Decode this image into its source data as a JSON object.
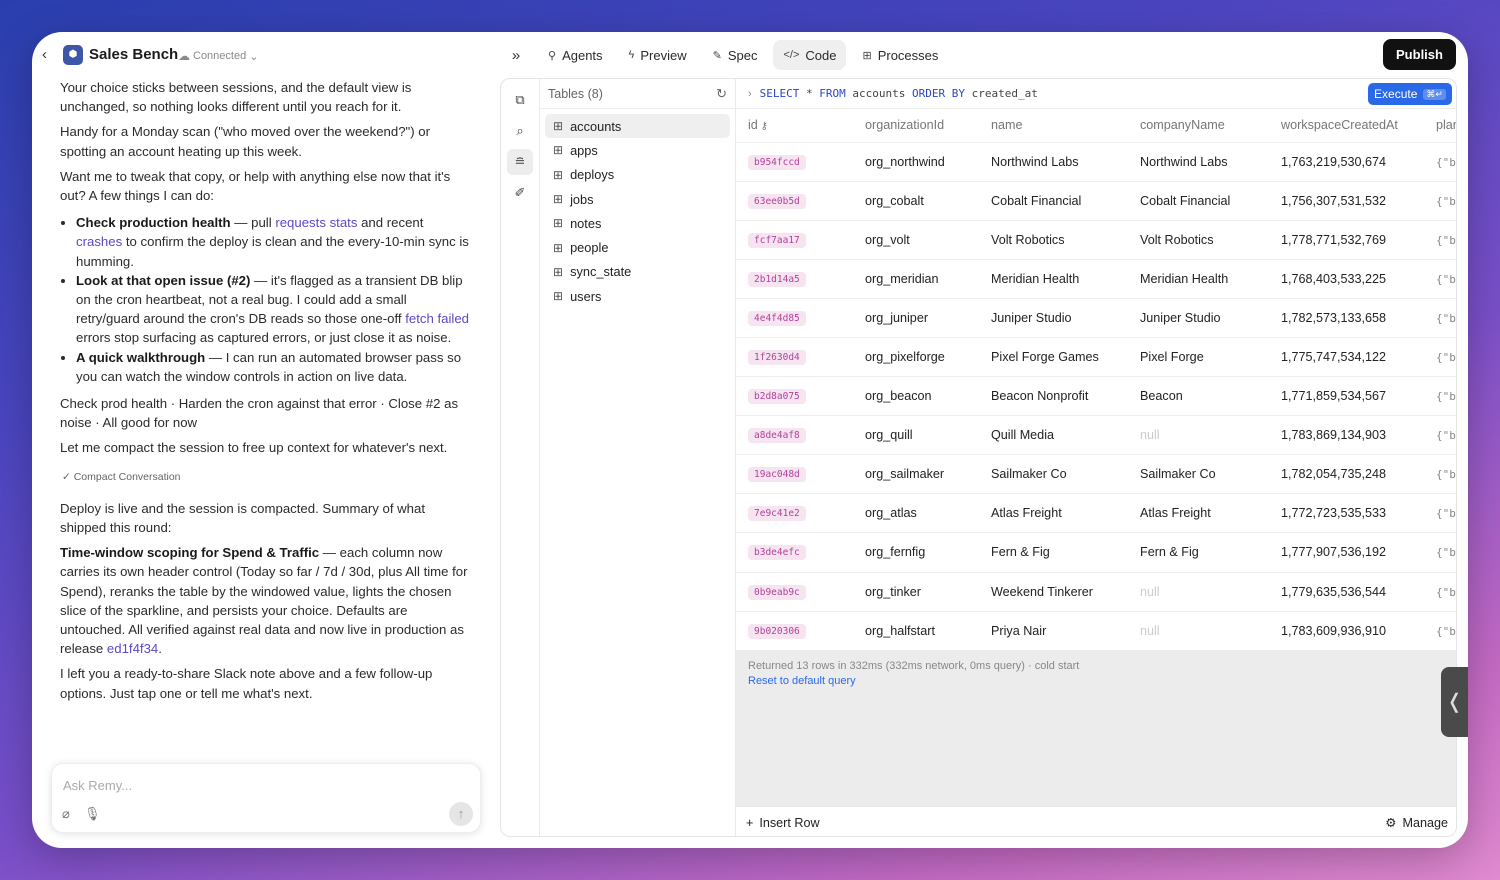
{
  "header": {
    "back_icon": "chevron-left-icon",
    "app_icon": "app-logo-icon",
    "title": "Sales Bench",
    "connection": "Connected",
    "tabs": [
      {
        "label": "Agents",
        "icon": "agents-icon"
      },
      {
        "label": "Preview",
        "icon": "bolt-icon"
      },
      {
        "label": "Spec",
        "icon": "edit-icon"
      },
      {
        "label": "Code",
        "icon": "code-icon"
      },
      {
        "label": "Processes",
        "icon": "cpu-icon"
      }
    ],
    "active_tab": "Code",
    "publish": "Publish"
  },
  "chat": {
    "p1": "Your choice sticks between sessions, and the default view is unchanged, so nothing looks different until you reach for it.",
    "p2": "Handy for a Monday scan (\"who moved over the weekend?\") or spotting an account heating up this week.",
    "p3": "Want me to tweak that copy, or help with anything else now that it's out? A few things I can do:",
    "b1": {
      "title": "Check production health",
      "t1": " — pull ",
      "link1": "requests stats",
      "t2": " and recent ",
      "link2": "crashes",
      "t3": " to confirm the deploy is clean and the every-10-min sync is humming."
    },
    "b2": {
      "title": "Look at that open issue (#2)",
      "t1": " — it's flagged as a transient DB blip on the cron heartbeat, not a real bug. I could add a small retry/guard around the cron's DB reads so those one-off ",
      "link1": "fetch failed",
      "t2": " errors stop surfacing as captured errors, or just close it as noise."
    },
    "b3": {
      "title": "A quick walkthrough",
      "t1": " — I can run an automated browser pass so you can watch the window controls in action on live data."
    },
    "options": "Check prod health · Harden the cron against that error · Close #2 as noise · All good for now",
    "p4": "Let me compact the session to free up context for whatever's next.",
    "compact": "Compact Conversation",
    "p5": "Deploy is live and the session is compacted. Summary of what shipped this round:",
    "p6": {
      "title": "Time-window scoping for Spend & Traffic",
      "t1": " — each column now carries its own header control (Today so far / 7d / 30d, plus All time for Spend), reranks the table by the windowed value, lights the chosen slice of the sparkline, and persists your choice. Defaults are untouched. All verified against real data and now live in production as release ",
      "link1": "ed1f4f34",
      "t2": "."
    },
    "p7": "I left you a ready-to-share Slack note above and a few follow-up options. Just tap one or tell me what's next.",
    "input_placeholder": "Ask Remy...",
    "input_value": ""
  },
  "tables_panel": {
    "title": "Tables (8)",
    "items": [
      "accounts",
      "apps",
      "deploys",
      "jobs",
      "notes",
      "people",
      "sync_state",
      "users"
    ],
    "active": "accounts"
  },
  "query": {
    "select": "SELECT",
    "star": "*",
    "from": "FROM",
    "table": "accounts",
    "order": "ORDER BY",
    "field": "created_at",
    "execute": "Execute",
    "shortcut": "⌘↵"
  },
  "grid": {
    "columns": [
      "id",
      "organizationId",
      "name",
      "companyName",
      "workspaceCreatedAt",
      "plan"
    ],
    "rows": [
      [
        "b954fccd",
        "org_northwind",
        "Northwind Labs",
        "Northwind Labs",
        "1,763,219,530,674",
        "{\"b"
      ],
      [
        "63ee0b5d",
        "org_cobalt",
        "Cobalt Financial",
        "Cobalt Financial",
        "1,756,307,531,532",
        "{\"b"
      ],
      [
        "fcf7aa17",
        "org_volt",
        "Volt Robotics",
        "Volt Robotics",
        "1,778,771,532,769",
        "{\"b"
      ],
      [
        "2b1d14a5",
        "org_meridian",
        "Meridian Health",
        "Meridian Health",
        "1,768,403,533,225",
        "{\"b"
      ],
      [
        "4e4f4d85",
        "org_juniper",
        "Juniper Studio",
        "Juniper Studio",
        "1,782,573,133,658",
        "{\"b"
      ],
      [
        "1f2630d4",
        "org_pixelforge",
        "Pixel Forge Games",
        "Pixel Forge",
        "1,775,747,534,122",
        "{\"b"
      ],
      [
        "b2d8a075",
        "org_beacon",
        "Beacon Nonprofit",
        "Beacon",
        "1,771,859,534,567",
        "{\"b"
      ],
      [
        "a8de4af8",
        "org_quill",
        "Quill Media",
        "null",
        "1,783,869,134,903",
        "{\"b"
      ],
      [
        "19ac048d",
        "org_sailmaker",
        "Sailmaker Co",
        "Sailmaker Co",
        "1,782,054,735,248",
        "{\"b"
      ],
      [
        "7e9c41e2",
        "org_atlas",
        "Atlas Freight",
        "Atlas Freight",
        "1,772,723,535,533",
        "{\"b"
      ],
      [
        "b3de4efc",
        "org_fernfig",
        "Fern & Fig",
        "Fern & Fig",
        "1,777,907,536,192",
        "{\"b"
      ],
      [
        "0b9eab9c",
        "org_tinker",
        "Weekend Tinkerer",
        "null",
        "1,779,635,536,544",
        "{\"b"
      ],
      [
        "9b020306",
        "org_halfstart",
        "Priya Nair",
        "null",
        "1,783,609,936,910",
        "{\"b"
      ]
    ],
    "status": "Returned 13 rows in 332ms (332ms network, 0ms query) · cold start",
    "reset": "Reset to default query",
    "insert": "Insert Row",
    "manage": "Manage"
  },
  "colors": {
    "accent": "#2a6ae8",
    "link": "#5a4ac8",
    "id_chip": "#b0449a",
    "publish_bg": "#111111"
  }
}
